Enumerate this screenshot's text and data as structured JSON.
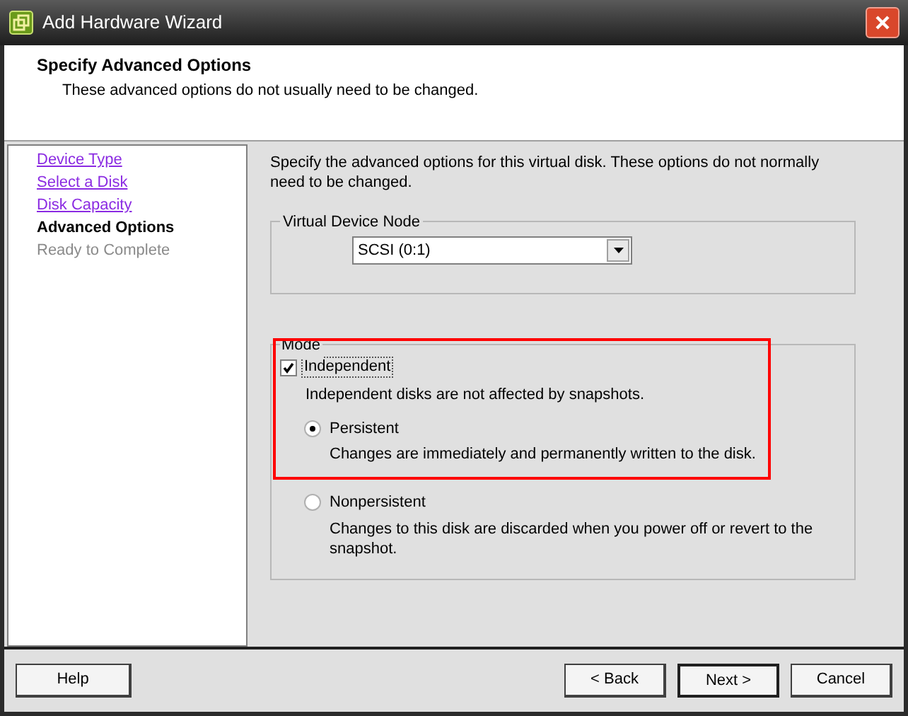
{
  "window": {
    "title": "Add Hardware Wizard"
  },
  "header": {
    "title": "Specify Advanced Options",
    "subtitle": "These advanced options do not usually need to be changed."
  },
  "steps": [
    {
      "label": "Device Type",
      "kind": "visited"
    },
    {
      "label": "Select a Disk",
      "kind": "visited"
    },
    {
      "label": "Disk Capacity",
      "kind": "visited"
    },
    {
      "label": "Advanced Options",
      "kind": "current"
    },
    {
      "label": "Ready to Complete",
      "kind": "upcoming"
    }
  ],
  "intro": "Specify the advanced options for this virtual disk. These options do not normally need to be changed.",
  "device_node": {
    "legend": "Virtual Device Node",
    "value": "SCSI (0:1)"
  },
  "mode": {
    "legend": "Mode",
    "independent": {
      "label": "Independent",
      "checked": true,
      "description": "Independent disks are not affected by snapshots."
    },
    "options": [
      {
        "label": "Persistent",
        "selected": true,
        "description": "Changes are immediately and permanently written to the disk."
      },
      {
        "label": "Nonpersistent",
        "selected": false,
        "description": "Changes to this disk are discarded when you power off or revert to the snapshot."
      }
    ]
  },
  "buttons": {
    "help": "Help",
    "back": "< Back",
    "next": "Next >",
    "cancel": "Cancel"
  }
}
